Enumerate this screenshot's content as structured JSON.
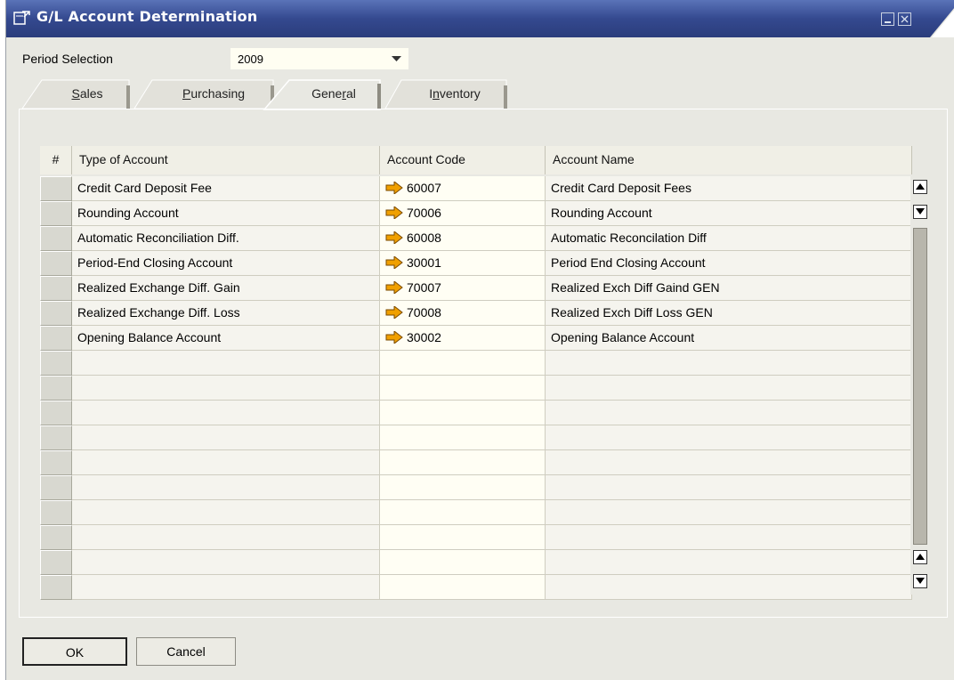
{
  "window": {
    "title": "G/L Account Determination",
    "title_bar_color": "#3a4f93"
  },
  "period": {
    "label": "Period Selection",
    "value": "2009"
  },
  "tabs": [
    {
      "label_pre": "",
      "accel": "S",
      "label_post": "ales",
      "active": false
    },
    {
      "label_pre": "",
      "accel": "P",
      "label_post": "urchasing",
      "active": false
    },
    {
      "label_pre": "Gene",
      "accel": "r",
      "label_post": "al",
      "active": true
    },
    {
      "label_pre": "I",
      "accel": "n",
      "label_post": "ventory",
      "active": false
    }
  ],
  "grid": {
    "headers": {
      "num": "#",
      "type": "Type of Account",
      "code": "Account Code",
      "name": "Account Name"
    },
    "rows": [
      {
        "type": "Credit Card Deposit Fee",
        "code": "60007",
        "name": "Credit Card Deposit Fees"
      },
      {
        "type": "Rounding Account",
        "code": "70006",
        "name": "Rounding Account"
      },
      {
        "type": "Automatic Reconciliation Diff.",
        "code": "60008",
        "name": "Automatic Reconcilation Diff"
      },
      {
        "type": "Period-End Closing Account",
        "code": "30001",
        "name": "Period End Closing Account"
      },
      {
        "type": "Realized Exchange Diff. Gain",
        "code": "70007",
        "name": "Realized Exch Diff Gaind GEN"
      },
      {
        "type": "Realized Exchange Diff. Loss",
        "code": "70008",
        "name": "Realized Exch Diff Loss  GEN"
      },
      {
        "type": "Opening Balance Account",
        "code": "30002",
        "name": "Opening Balance Account"
      }
    ],
    "empty_rows": 10,
    "link_arrow_color": "#f0a000"
  },
  "buttons": {
    "ok": "OK",
    "cancel": "Cancel"
  }
}
